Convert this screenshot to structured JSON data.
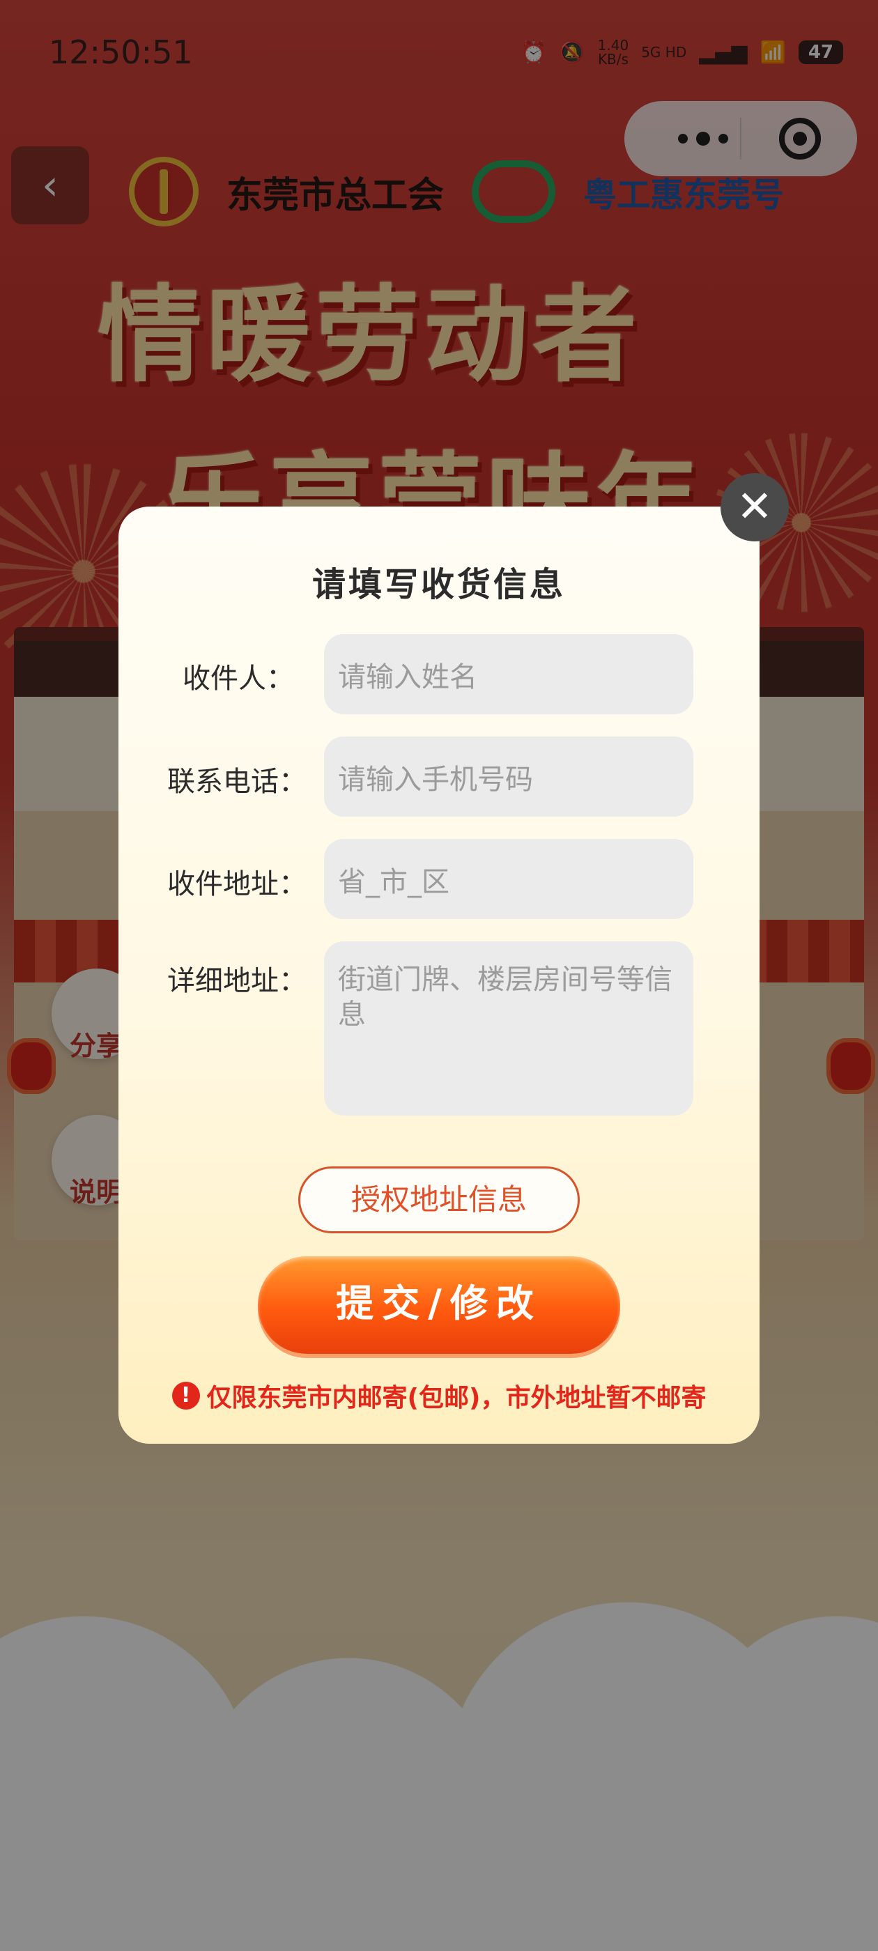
{
  "status_bar": {
    "time": "12:50:51",
    "network_speed_value": "1.40",
    "network_speed_unit": "KB/s",
    "network_type": "5G HD",
    "battery": "47"
  },
  "background": {
    "logo_left_text": "东莞市总工会",
    "logo_right_text": "粤工惠东莞号",
    "banner_line1": "情暖劳动者",
    "banner_line2": "乐享莞味年",
    "side_share_label": "分享",
    "side_info_label": "说明"
  },
  "dialog": {
    "title": "请填写收货信息",
    "fields": [
      {
        "label": "收件人：",
        "placeholder": "请输入姓名",
        "value": ""
      },
      {
        "label": "联系电话：",
        "placeholder": "请输入手机号码",
        "value": ""
      },
      {
        "label": "收件地址：",
        "placeholder": "省_市_区",
        "value": ""
      },
      {
        "label": "详细地址：",
        "placeholder": "街道门牌、楼层房间号等信息",
        "value": ""
      }
    ],
    "auth_button": "授权地址信息",
    "submit_button": "提交/修改",
    "notice_icon": "!",
    "notice": "仅限东莞市内邮寄(包邮)，市外地址暂不邮寄"
  },
  "icons": {
    "close": "close-icon",
    "back": "chevron-left-icon",
    "more": "more-dots-icon",
    "target": "target-icon",
    "warning": "warning-icon"
  },
  "colors": {
    "accent_orange": "#ff5a0f",
    "notice_red": "#e2261a",
    "dialog_bg": "#fff8e2"
  }
}
